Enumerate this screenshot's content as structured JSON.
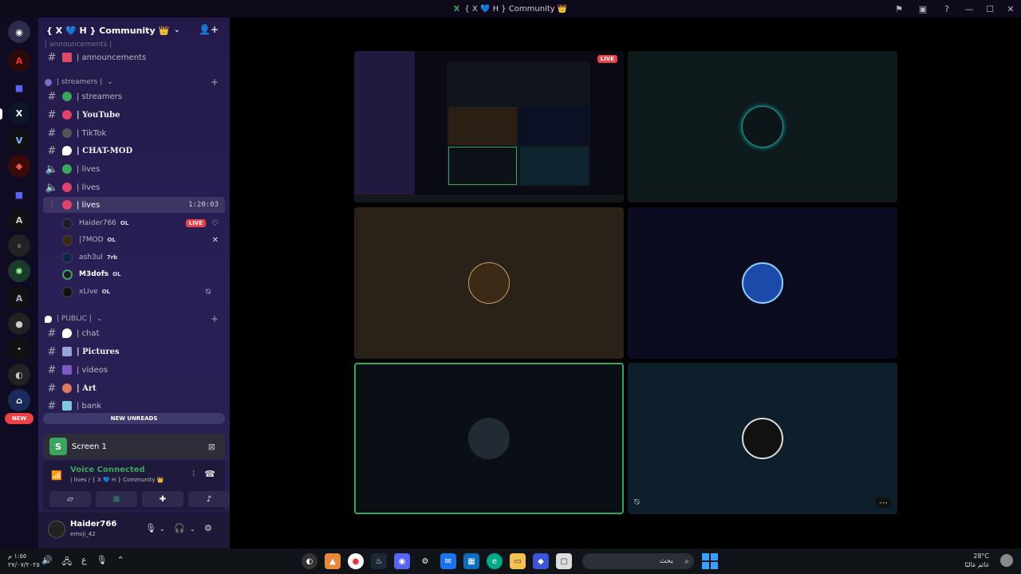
{
  "window": {
    "title": "{ X 💙 H } Community 👑",
    "title_icon": "X"
  },
  "rail": {
    "new_badge": "NEW"
  },
  "guild": {
    "name": "{ X 💙 H } Community 👑"
  },
  "channels": {
    "top_partial": "| announcements |",
    "announcements": "| announcements",
    "cat_streamers": "| streamers |",
    "streamers": "| streamers",
    "youtube": "| YouTube",
    "tiktok": "| TikTok",
    "chatmod": "| CHAT-MOD",
    "lives1": "| lives",
    "lives2": "| lives",
    "lives3": "| lives",
    "lives3_timer": "1:20:03",
    "cat_public": "| PUBLIC |",
    "chat": "| chat",
    "pictures": "| Pictures",
    "videos": "| videos",
    "art": "| Art",
    "bank": "| bank",
    "bank_partial": "| bank"
  },
  "voice_users": [
    {
      "name": "Haider766",
      "tag": "OL",
      "live": "LIVE"
    },
    {
      "name": "|7MOD",
      "tag": "OL"
    },
    {
      "name": "ash3ul",
      "tag": "7rb"
    },
    {
      "name": "M3dofs",
      "tag": "OL"
    },
    {
      "name": "xLive",
      "tag": "OL"
    }
  ],
  "new_unreads": "NEW UNREADS",
  "screen_panel": {
    "label": "Screen 1"
  },
  "voice_panel": {
    "status": "Voice Connected",
    "location": "| lives / { X 💙 H } Community 👑"
  },
  "user_panel": {
    "name": "Haider766",
    "status": "emoji_42"
  },
  "stage": {
    "live_tag": "LIVE"
  },
  "taskbar": {
    "time": "١:٥٥ م",
    "date": "٢٧/٠٧/٢٠٢٥",
    "lang": "ع",
    "search_placeholder": "بحث",
    "temp": "28°C",
    "weather_text": "غائم غالبًا"
  },
  "colors": {
    "accent_green": "#3ba55d",
    "live_red": "#ed4245",
    "sidebar_bg": "#2a1f56"
  },
  "icons": {
    "add_user": "add-user-icon",
    "hash": "hash-icon",
    "speaker": "speaker-icon"
  }
}
